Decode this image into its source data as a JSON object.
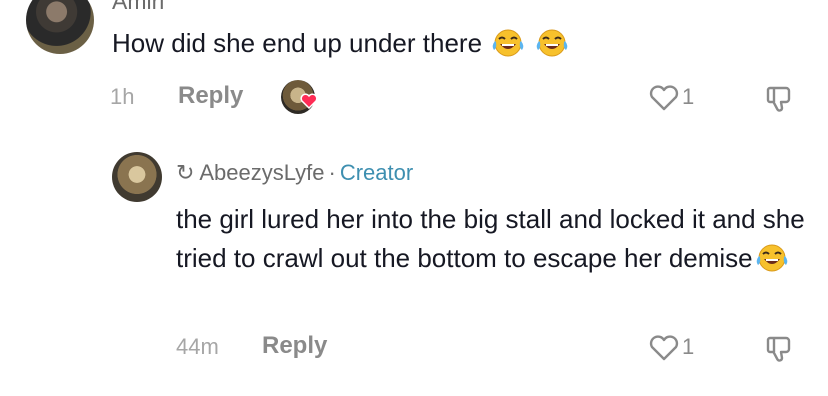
{
  "comment1": {
    "author": "Amiri",
    "text": "How did she end up under there",
    "emojis": [
      "face-with-tears-of-joy-icon",
      "face-with-tears-of-joy-icon"
    ],
    "time": "1h",
    "reply_label": "Reply",
    "like_count": "1"
  },
  "comment2": {
    "reply_indicator": "↻",
    "author": "AbeezysLyfe",
    "separator": "·",
    "badge": "Creator",
    "text": "the girl lured her into the big stall and locked it and she tried to crawl out the bottom to escape her demise",
    "emojis": [
      "face-with-tears-of-joy-icon"
    ],
    "time": "44m",
    "reply_label": "Reply",
    "like_count": "1"
  },
  "colors": {
    "text": "#161823",
    "muted": "#8a8a8a",
    "timestamp": "#a6a6a6",
    "creator_badge": "#3e8fb0",
    "heart_badge": "#fe2c55"
  }
}
